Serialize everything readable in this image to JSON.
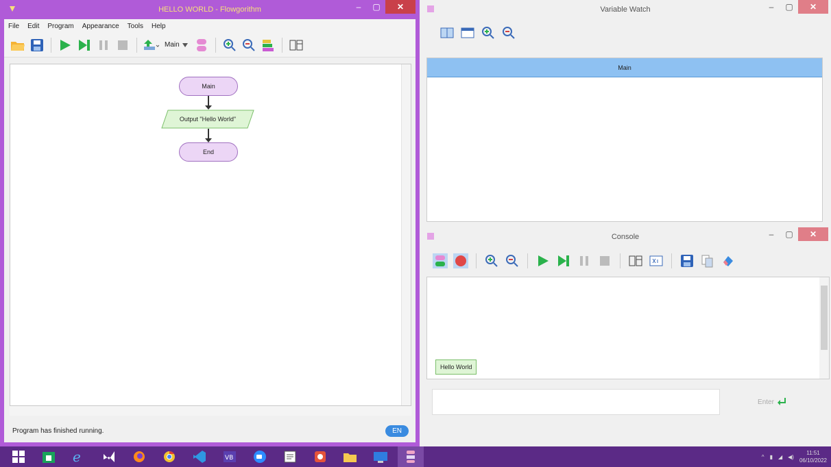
{
  "flowgorithm": {
    "title": "HELLO WORLD - Flowgorithm",
    "menu": [
      "File",
      "Edit",
      "Program",
      "Appearance",
      "Tools",
      "Help"
    ],
    "function_select": "Main",
    "chart": {
      "start": "Main",
      "output": "Output \"Hello World\"",
      "end": "End"
    },
    "status": "Program has finished running.",
    "language_badge": "EN"
  },
  "watch": {
    "title": "Variable Watch",
    "column_header": "Main"
  },
  "console": {
    "title": "Console",
    "output_bubble": "Hello World",
    "enter_label": "Enter"
  },
  "window_controls": {
    "minimize": "–",
    "maximize": "▢",
    "close": "✕"
  },
  "tray": {
    "time": "11:51",
    "date": "06/10/2022"
  },
  "colors": {
    "accent": "#b05bd8",
    "terminal_fill": "#ecd6f6",
    "io_fill": "#dff5d6",
    "watch_header": "#8ec1f2",
    "taskbar": "#5b2a86"
  }
}
